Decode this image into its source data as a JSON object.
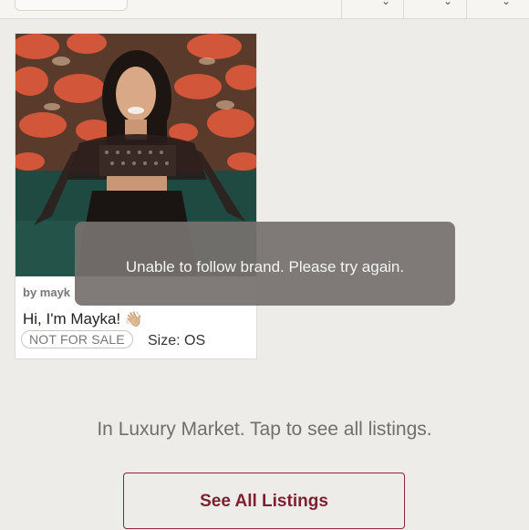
{
  "header": {
    "icons": [
      "dropdown-icon",
      "dropdown-icon",
      "menu-icon"
    ]
  },
  "listing": {
    "byline": "by mayk",
    "title": "Hi, I'm Mayka!",
    "title_emoji": "👋🏼",
    "badge": "NOT FOR SALE",
    "size": "Size: OS"
  },
  "toast": {
    "message": "Unable to follow brand. Please try again."
  },
  "market": {
    "info": "In Luxury Market. Tap to see all listings.",
    "button_label": "See All Listings"
  },
  "colors": {
    "background": "#eeece8",
    "accent": "#7d1f30",
    "toast_bg": "#76706e"
  }
}
